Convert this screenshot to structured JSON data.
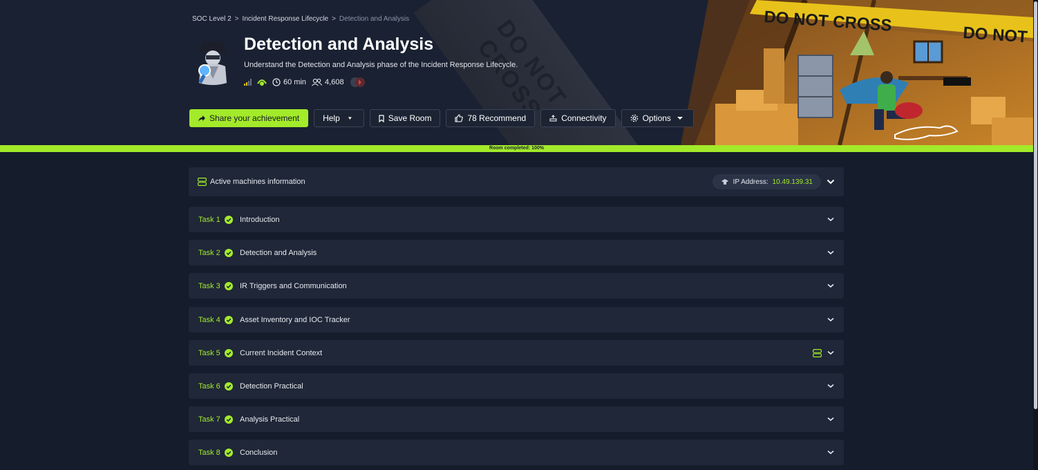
{
  "breadcrumb": {
    "items": [
      "SOC Level 2",
      "Incident Response Lifecycle",
      "Detection and Analysis"
    ],
    "separator": ">"
  },
  "hero_art": {
    "tape_text": "DO NOT CROSS",
    "tape_text_2": "DO NOT",
    "faded_tape_text": "DO NOT CROSS"
  },
  "room": {
    "title": "Detection and Analysis",
    "description": "Understand the Detection and Analysis phase of the Incident Response Lifecycle.",
    "duration": "60 min",
    "users": "4,608"
  },
  "buttons": {
    "share": "Share your achievement",
    "help": "Help",
    "save": "Save Room",
    "recommend": "78 Recommend",
    "connectivity": "Connectivity",
    "options": "Options"
  },
  "progress": {
    "label": "Room completed: 100%",
    "fraction": 1.0
  },
  "machines": {
    "label": "Active machines information",
    "ip_label": "IP Address:",
    "ip_value": "10.49.139.31"
  },
  "tasks": [
    {
      "number": "Task 1",
      "title": "Introduction"
    },
    {
      "number": "Task 2",
      "title": "Detection and Analysis"
    },
    {
      "number": "Task 3",
      "title": "IR Triggers and Communication"
    },
    {
      "number": "Task 4",
      "title": "Asset Inventory and IOC Tracker"
    },
    {
      "number": "Task 5",
      "title": "Current Incident Context"
    },
    {
      "number": "Task 6",
      "title": "Detection Practical"
    },
    {
      "number": "Task 7",
      "title": "Analysis Practical"
    },
    {
      "number": "Task 8",
      "title": "Conclusion"
    }
  ],
  "colors": {
    "accent": "#a3ea2a",
    "background": "#151c2b",
    "card": "#1f2738"
  }
}
